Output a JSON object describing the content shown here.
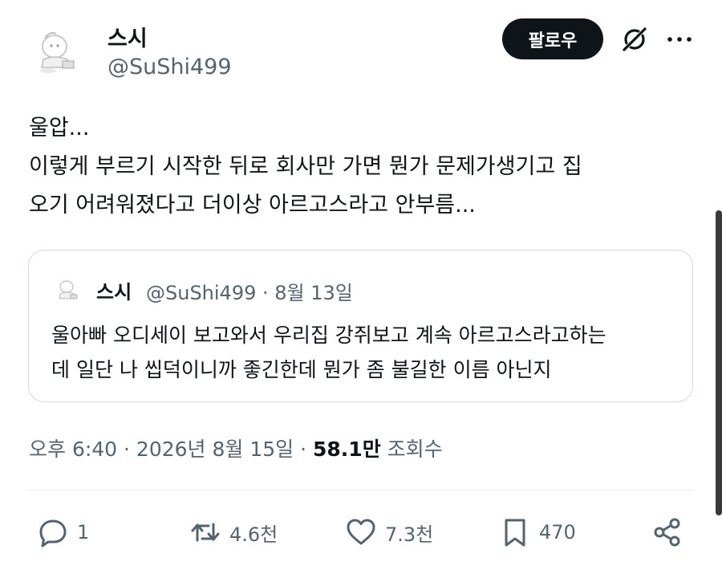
{
  "author": {
    "display_name": "스시",
    "handle": "@SuShi499"
  },
  "header": {
    "follow_label": "팔로우",
    "grok_icon": "grok-icon",
    "more_icon": "more-icon"
  },
  "tweet": {
    "lines": [
      "울압...",
      "이렇게 부르기 시작한 뒤로 회사만 가면 뭔가 문제가생기고 집",
      "오기 어려워졌다고 더이상 아르고스라고 안부름..."
    ]
  },
  "quote": {
    "display_name": "스시",
    "meta": "@SuShi499 · 8월 13일",
    "lines": [
      "울아빠 오디세이 보고와서 우리집 강쥐보고 계속 아르고스라고하는",
      "데 일단 나 씹덕이니까 좋긴한데 뭔가 좀 불길한 이름 아닌지"
    ]
  },
  "meta": {
    "timestamp": "오후 6:40 · 2026년 8월 15일 · ",
    "views_count": "58.1만",
    "views_label": " 조회수"
  },
  "actions": {
    "replies": "1",
    "reposts": "4.6천",
    "likes": "7.3천",
    "bookmarks": "470"
  },
  "colors": {
    "text": "#0f1419",
    "secondary": "#536471",
    "border": "#cfd9de",
    "button": "#0f1419"
  }
}
